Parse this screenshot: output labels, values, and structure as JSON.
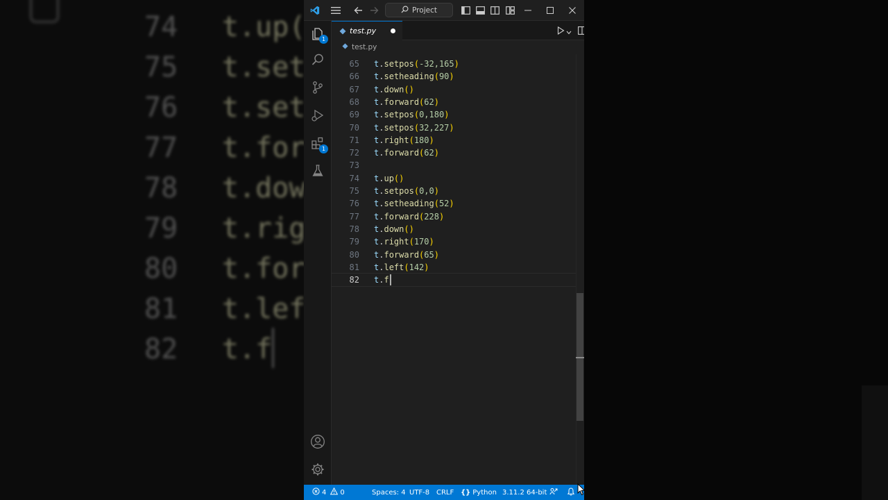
{
  "background": {
    "lines": [
      {
        "num": "74",
        "code": "t.up("
      },
      {
        "num": "75",
        "code": "t.set"
      },
      {
        "num": "76",
        "code": "t.set"
      },
      {
        "num": "77",
        "code": "t.for"
      },
      {
        "num": "78",
        "code": "t.dow"
      },
      {
        "num": "79",
        "code": "t.rig"
      },
      {
        "num": "80",
        "code": "t.for"
      },
      {
        "num": "81",
        "code": "t.lef"
      },
      {
        "num": "82",
        "code": "t.f"
      }
    ]
  },
  "titlebar": {
    "search_placeholder": "Project",
    "icons": [
      "vscode-logo",
      "menu-icon",
      "back-arrow-icon",
      "forward-arrow-icon",
      "search-icon",
      "toggle-primary-sidebar-icon",
      "toggle-panel-icon",
      "toggle-secondary-sidebar-icon",
      "customize-layout-icon",
      "minimize-icon",
      "maximize-icon",
      "close-icon"
    ]
  },
  "activity_bar": {
    "items": [
      {
        "name": "explorer",
        "icon": "files-icon",
        "badge": "1"
      },
      {
        "name": "search",
        "icon": "search-icon"
      },
      {
        "name": "source-control",
        "icon": "source-control-icon"
      },
      {
        "name": "run-debug",
        "icon": "run-debug-icon"
      },
      {
        "name": "extensions",
        "icon": "extensions-icon",
        "badge": "1"
      },
      {
        "name": "testing",
        "icon": "flask-icon"
      }
    ],
    "bottom": [
      {
        "name": "accounts",
        "icon": "account-icon"
      },
      {
        "name": "manage",
        "icon": "gear-icon"
      }
    ]
  },
  "tab": {
    "label": "test.py",
    "modified": true
  },
  "breadcrumb": {
    "file": "test.py"
  },
  "editor": {
    "current_line": "82",
    "lines": [
      {
        "num": "65",
        "obj": "t",
        "fn": "setpos",
        "arg": "-32,165"
      },
      {
        "num": "66",
        "obj": "t",
        "fn": "setheading",
        "arg": "90"
      },
      {
        "num": "67",
        "obj": "t",
        "fn": "down",
        "arg": ""
      },
      {
        "num": "68",
        "obj": "t",
        "fn": "forward",
        "arg": "62"
      },
      {
        "num": "69",
        "obj": "t",
        "fn": "setpos",
        "arg": "0,180"
      },
      {
        "num": "70",
        "obj": "t",
        "fn": "setpos",
        "arg": "32,227"
      },
      {
        "num": "71",
        "obj": "t",
        "fn": "right",
        "arg": "180"
      },
      {
        "num": "72",
        "obj": "t",
        "fn": "forward",
        "arg": "62"
      },
      {
        "num": "73",
        "blank": true
      },
      {
        "num": "74",
        "obj": "t",
        "fn": "up",
        "arg": ""
      },
      {
        "num": "75",
        "obj": "t",
        "fn": "setpos",
        "arg": "0,0"
      },
      {
        "num": "76",
        "obj": "t",
        "fn": "setheading",
        "arg": "52"
      },
      {
        "num": "77",
        "obj": "t",
        "fn": "forward",
        "arg": "228"
      },
      {
        "num": "78",
        "obj": "t",
        "fn": "down",
        "arg": ""
      },
      {
        "num": "79",
        "obj": "t",
        "fn": "right",
        "arg": "170"
      },
      {
        "num": "80",
        "obj": "t",
        "fn": "forward",
        "arg": "65"
      },
      {
        "num": "81",
        "obj": "t",
        "fn": "left",
        "arg": "142"
      },
      {
        "num": "82",
        "obj": "t",
        "fn": "f",
        "partial": true
      }
    ]
  },
  "statusbar": {
    "errors": "4",
    "warnings": "0",
    "spaces": "Spaces: 4",
    "encoding": "UTF-8",
    "eol": "CRLF",
    "language": "Python",
    "interpreter": "3.11.2 64-bit"
  },
  "colors": {
    "accent": "#0078d4",
    "editor_bg": "#1f1f1f",
    "function": "#dcdcaa",
    "variable": "#9cdcfe",
    "bracket": "#ffd700",
    "number": "#b5cea8"
  }
}
